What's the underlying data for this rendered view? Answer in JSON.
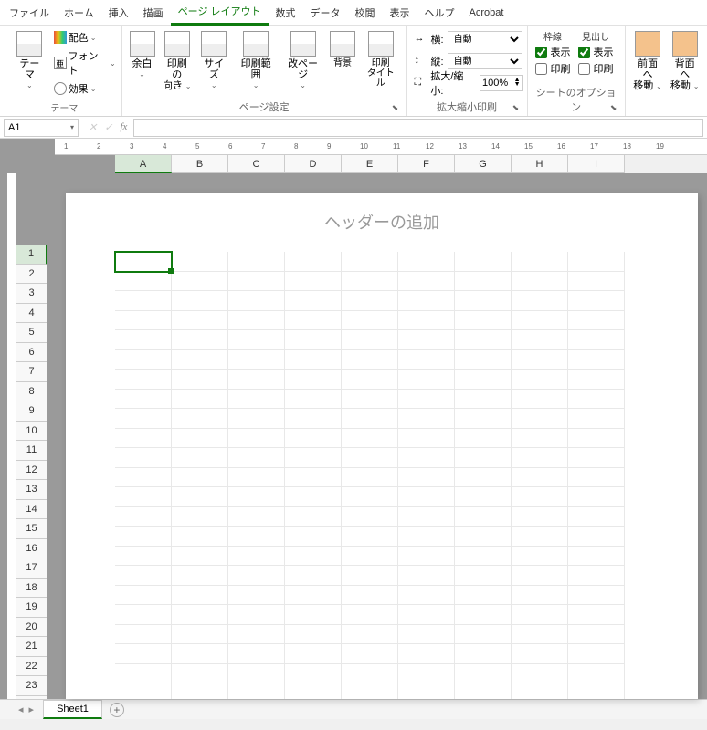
{
  "tabs": {
    "file": "ファイル",
    "home": "ホーム",
    "insert": "挿入",
    "draw": "描画",
    "page_layout": "ページ レイアウト",
    "formulas": "数式",
    "data": "データ",
    "review": "校閲",
    "view": "表示",
    "help": "ヘルプ",
    "acrobat": "Acrobat"
  },
  "ribbon": {
    "theme": {
      "themes": "テーマ",
      "colors": "配色",
      "fonts": "フォント",
      "effects": "効果",
      "group_label": "テーマ"
    },
    "page_setup": {
      "margins": "余白",
      "orientation": "印刷の\n向き",
      "size": "サイズ",
      "print_area": "印刷範囲",
      "breaks": "改ページ",
      "background": "背景",
      "print_titles": "印刷\nタイトル",
      "group_label": "ページ設定"
    },
    "scale": {
      "width_label": "横:",
      "height_label": "縦:",
      "scale_label": "拡大/縮小:",
      "auto": "自動",
      "scale_value": "100%",
      "group_label": "拡大縮小印刷"
    },
    "sheet_options": {
      "gridlines": "枠線",
      "headings": "見出し",
      "view": "表示",
      "print": "印刷",
      "group_label": "シートのオプション"
    },
    "arrange": {
      "bring_forward": "前面へ\n移動",
      "send_backward": "背面へ\n移動"
    }
  },
  "name_box": "A1",
  "header_placeholder": "ヘッダーの追加",
  "columns": [
    "A",
    "B",
    "C",
    "D",
    "E",
    "F",
    "G",
    "H",
    "I"
  ],
  "rows": [
    "1",
    "2",
    "3",
    "4",
    "5",
    "6",
    "7",
    "8",
    "9",
    "10",
    "11",
    "12",
    "13",
    "14",
    "15",
    "16",
    "17",
    "18",
    "19",
    "20",
    "21",
    "22",
    "23"
  ],
  "ruler_h": [
    "1",
    "2",
    "3",
    "4",
    "5",
    "6",
    "7",
    "8",
    "9",
    "10",
    "11",
    "12",
    "13",
    "14",
    "15",
    "16",
    "17",
    "18",
    "19"
  ],
  "sheet_tab": "Sheet1",
  "checkbox_states": {
    "gridlines_view": true,
    "gridlines_print": false,
    "headings_view": true,
    "headings_print": false
  }
}
